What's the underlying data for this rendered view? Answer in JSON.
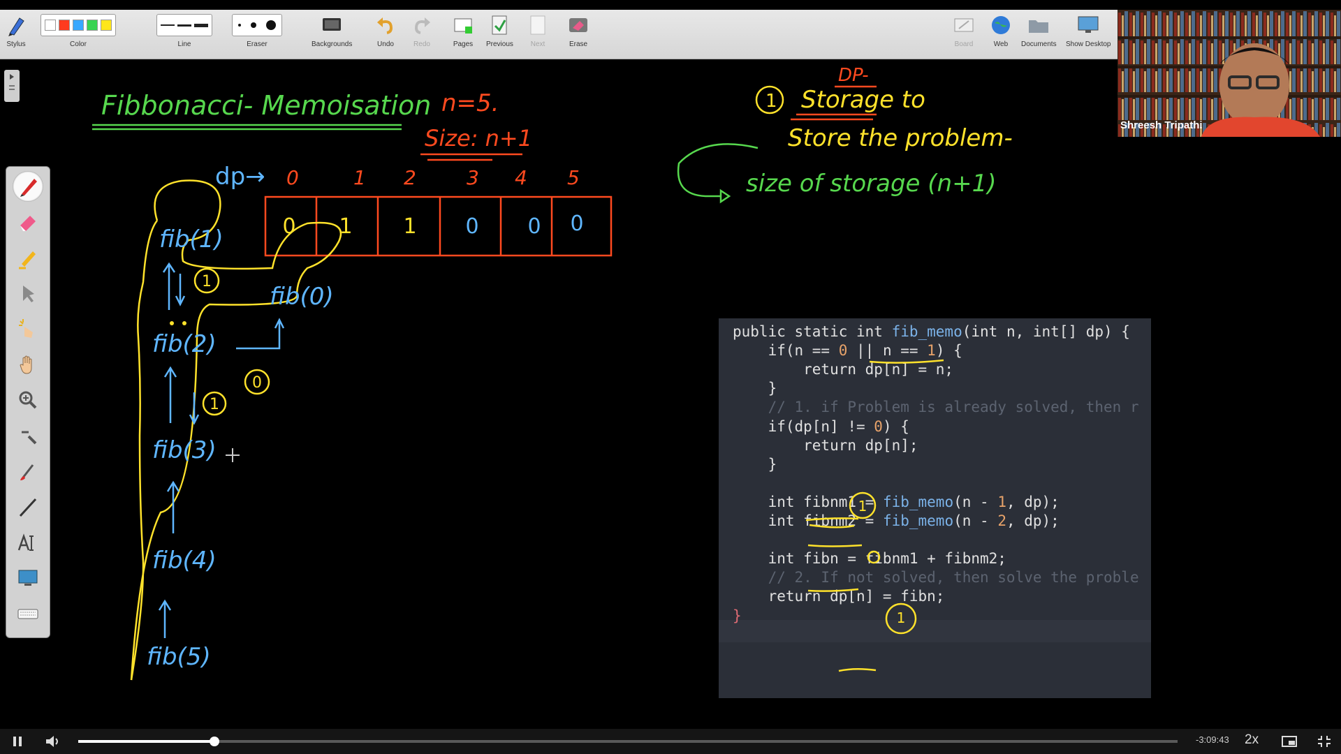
{
  "toolbar": {
    "stylus": "Stylus",
    "color": "Color",
    "line": "Line",
    "eraser": "Eraser",
    "backgrounds": "Backgrounds",
    "undo": "Undo",
    "redo": "Redo",
    "pages": "Pages",
    "previous": "Previous",
    "next": "Next",
    "erase": "Erase",
    "board": "Board",
    "web": "Web",
    "documents": "Documents",
    "show_desktop": "Show Desktop",
    "colors": [
      "#ffffff",
      "#ff3b1f",
      "#38a8ff",
      "#39d353",
      "#ffe61b"
    ]
  },
  "webcam": {
    "name": "Shreesh Tripathi"
  },
  "board": {
    "title": "Fibbonacci- Memoisation",
    "n_value": "n=5.",
    "size_note": "Size: n+1",
    "dp_label": "dp→",
    "indices": [
      "0",
      "1",
      "2",
      "3",
      "4",
      "5"
    ],
    "dp_values": [
      "0",
      "1",
      "1",
      "0",
      "0",
      "0"
    ],
    "dp_heading": "DP-",
    "note_1": "Storage to",
    "note_2": "Store the problem-",
    "note_3": "size of storage (n+1)",
    "tree": [
      "fib(1)",
      "fib(0)",
      "fib(2)",
      "fib(3)",
      "fib(4)",
      "fib(5)"
    ],
    "tree_values": [
      "1",
      "0",
      "1"
    ],
    "colors": {
      "pen_yellow": "#ffe22b",
      "pen_blue": "#5fb6ff",
      "pen_green": "#57d84e",
      "pen_red": "#ff4a1f"
    }
  },
  "code": {
    "lines": [
      [
        "public static int ",
        "fib_memo",
        "(int n, int[] dp) {"
      ],
      [
        "    if(n == ",
        "0",
        " || n == ",
        "1",
        ") {"
      ],
      [
        "        return dp[n] = n;"
      ],
      [
        "    }"
      ],
      [
        "    // 1. if Problem is already solved, then r"
      ],
      [
        "    if(dp[n] != ",
        "0",
        ") {"
      ],
      [
        "        return dp[n];"
      ],
      [
        "    }"
      ],
      [
        ""
      ],
      [
        "    int fibnm1 = ",
        "fib_memo",
        "(n - ",
        "1",
        ", dp);"
      ],
      [
        "    int fibnm2 = ",
        "fib_memo",
        "(n - ",
        "2",
        ", dp);"
      ],
      [
        ""
      ],
      [
        "    int fibn = fibnm1 + fibnm2;"
      ],
      [
        "    // 2. If not solved, then solve the proble"
      ],
      [
        "    return dp[n] = fibn;"
      ],
      [
        "}"
      ]
    ],
    "annotations": [
      "1",
      "0",
      "1"
    ]
  },
  "player": {
    "time_remaining": "-3:09:43",
    "speed": "2x",
    "progress": 0.124
  }
}
